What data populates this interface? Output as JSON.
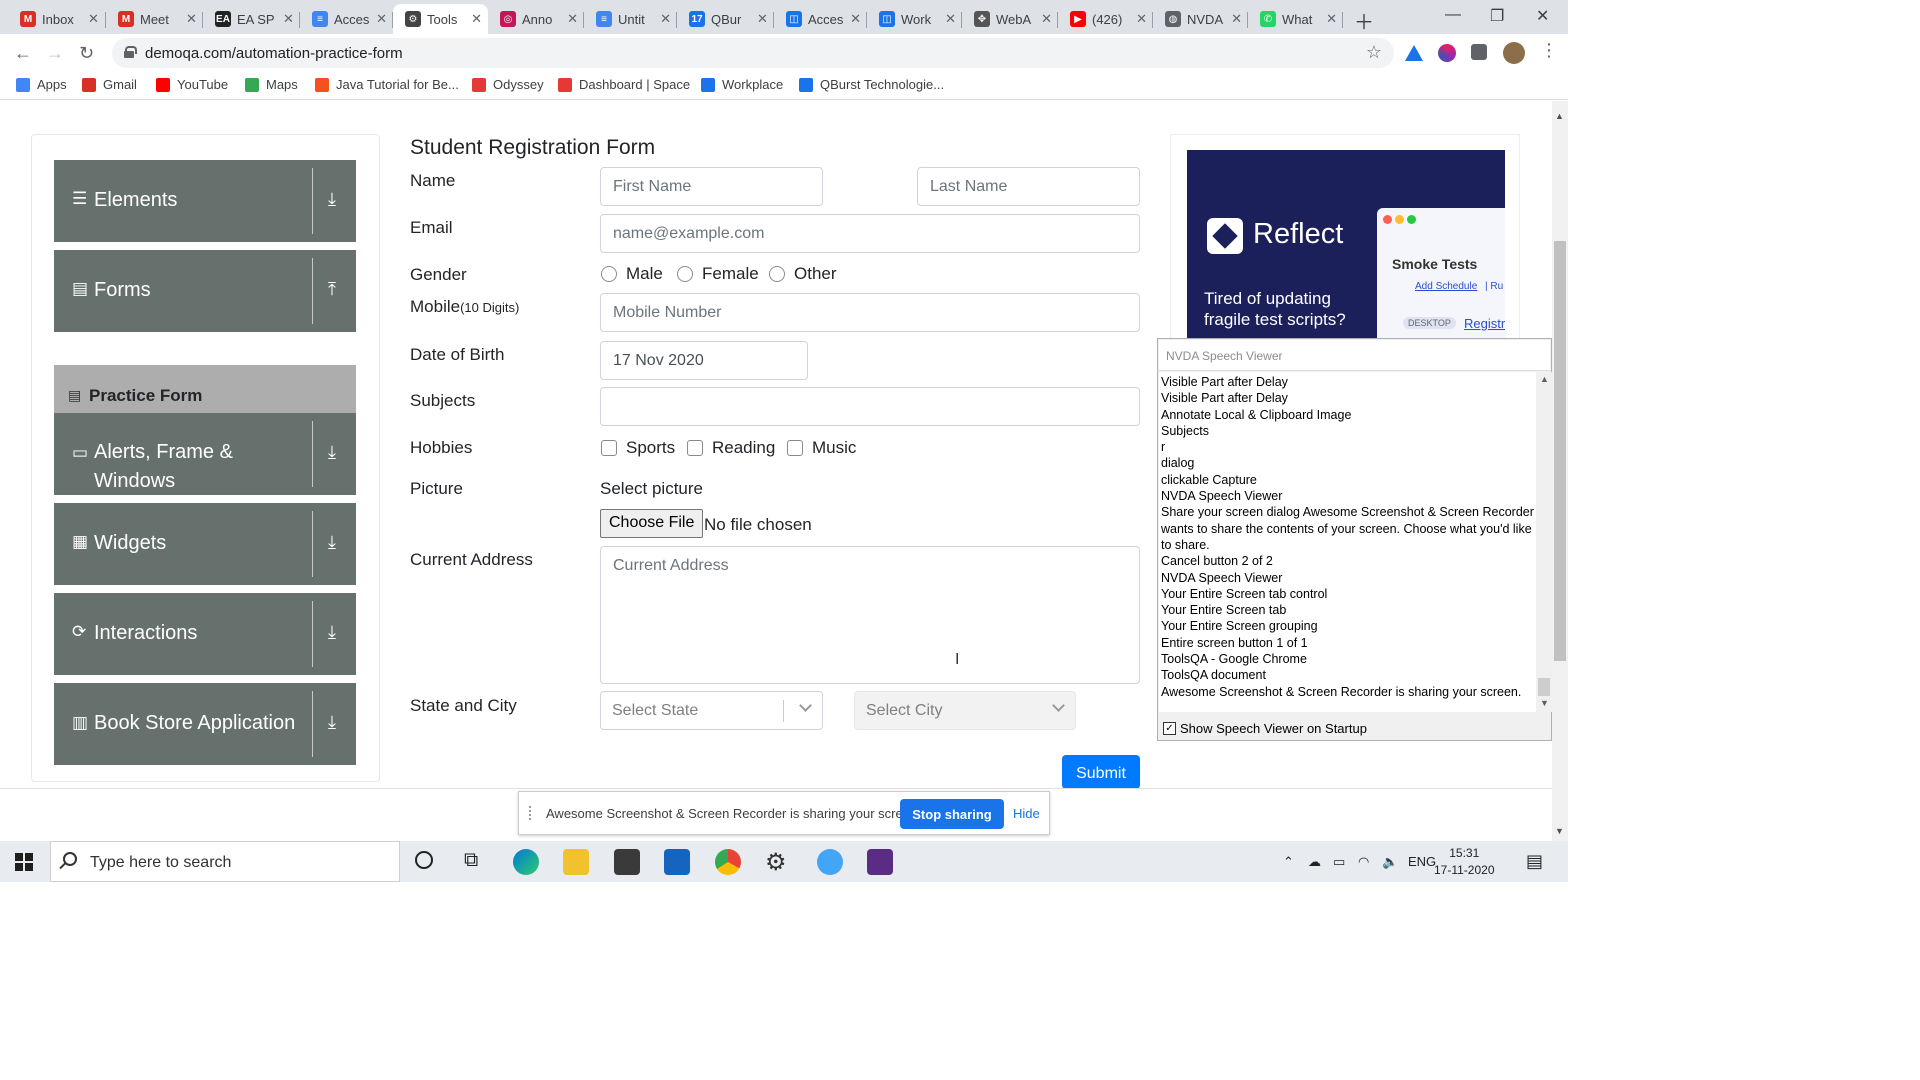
{
  "browser": {
    "tabs": [
      {
        "label": "Inbox",
        "icon": "gmail-icon",
        "color": "#d93025",
        "glyph": "M"
      },
      {
        "label": "Meet",
        "icon": "gmail-icon",
        "color": "#d93025",
        "glyph": "M"
      },
      {
        "label": "EA SP",
        "icon": "ea-icon",
        "color": "#222222",
        "glyph": "EA"
      },
      {
        "label": "Acces",
        "icon": "docs-icon",
        "color": "#4285f4",
        "glyph": "≡"
      },
      {
        "label": "Tools",
        "icon": "gear-icon",
        "color": "#444444",
        "glyph": "⚙",
        "active": true
      },
      {
        "label": "Anno",
        "icon": "annotate-icon",
        "color": "#c2185b",
        "glyph": "◎"
      },
      {
        "label": "Untit",
        "icon": "docs-icon",
        "color": "#4285f4",
        "glyph": "≡"
      },
      {
        "label": "QBur",
        "icon": "calendar-icon",
        "color": "#1a73e8",
        "glyph": "17"
      },
      {
        "label": "Acces",
        "icon": "workplace-icon",
        "color": "#1a73e8",
        "glyph": "◫"
      },
      {
        "label": "Work",
        "icon": "workplace-icon",
        "color": "#1a73e8",
        "glyph": "◫"
      },
      {
        "label": "WebA",
        "icon": "extension-icon",
        "color": "#555555",
        "glyph": "✥"
      },
      {
        "label": "(426)",
        "icon": "youtube-icon",
        "color": "#ff0000",
        "glyph": "▶"
      },
      {
        "label": "NVDA",
        "icon": "globe-icon",
        "color": "#5f6368",
        "glyph": "◍"
      },
      {
        "label": "What",
        "icon": "whatsapp-icon",
        "color": "#25d366",
        "glyph": "✆"
      }
    ],
    "url": "demoqa.com/automation-practice-form",
    "bookmarks": [
      {
        "label": "Apps",
        "color": "#4285f4"
      },
      {
        "label": "Gmail",
        "color": "#d93025"
      },
      {
        "label": "YouTube",
        "color": "#ff0000"
      },
      {
        "label": "Maps",
        "color": "#34a853"
      },
      {
        "label": "Java Tutorial for Be...",
        "color": "#f4511e"
      },
      {
        "label": "Odyssey",
        "color": "#e53935"
      },
      {
        "label": "Dashboard | Space",
        "color": "#e53935"
      },
      {
        "label": "Workplace",
        "color": "#1a73e8"
      },
      {
        "label": "QBurst Technologie...",
        "color": "#1a73e8"
      }
    ]
  },
  "sidebar": {
    "groups": [
      {
        "label": "Elements",
        "icon": "hamburger-icon",
        "arrow": "download-arrow-icon"
      },
      {
        "label": "Forms",
        "icon": "document-icon",
        "arrow": "upload-arrow-icon"
      },
      {
        "label": "Alerts, Frame & Windows",
        "icon": "window-icon",
        "arrow": "download-arrow-icon"
      },
      {
        "label": "Widgets",
        "icon": "widgets-icon",
        "arrow": "download-arrow-icon"
      },
      {
        "label": "Interactions",
        "icon": "interactions-icon",
        "arrow": "download-arrow-icon"
      },
      {
        "label": "Book Store Application",
        "icon": "bookstore-icon",
        "arrow": "download-arrow-icon"
      }
    ],
    "active_item": "Practice Form"
  },
  "form": {
    "title": "Student Registration Form",
    "name_label": "Name",
    "first_name_placeholder": "First Name",
    "last_name_placeholder": "Last Name",
    "email_label": "Email",
    "email_placeholder": "name@example.com",
    "gender_label": "Gender",
    "genders": [
      "Male",
      "Female",
      "Other"
    ],
    "mobile_label": "Mobile",
    "mobile_hint": "(10 Digits)",
    "mobile_placeholder": "Mobile Number",
    "dob_label": "Date of Birth",
    "dob_value": "17 Nov 2020",
    "subjects_label": "Subjects",
    "hobbies_label": "Hobbies",
    "hobbies": [
      "Sports",
      "Reading",
      "Music"
    ],
    "picture_label": "Picture",
    "select_picture": "Select picture",
    "choose_file": "Choose File",
    "no_file": "No file chosen",
    "address_label": "Current Address",
    "address_placeholder": "Current Address",
    "state_city_label": "State and City",
    "state_placeholder": "Select State",
    "city_placeholder": "Select City",
    "submit": "Submit"
  },
  "ad": {
    "brand": "Reflect",
    "tagline": "Tired of updating fragile test scripts?",
    "card_title": "Smoke Tests",
    "schedule": "Add Schedule",
    "schedule_sep": "| Ru",
    "badge": "DESKTOP",
    "link": "Registr"
  },
  "nvda": {
    "title": "NVDA Speech Viewer",
    "lines": [
      "Visible Part after Delay",
      "Visible Part after Delay",
      "Annotate Local & Clipboard Image",
      "Subjects",
      "r",
      "dialog",
      "clickable  Capture",
      "NVDA Speech Viewer",
      "Share your screen  dialog  Awesome Screenshot & Screen Recorder wants to share the contents of your screen. Choose what you'd like to share.",
      "Cancel  button  2 of 2",
      "NVDA Speech Viewer",
      "Your Entire Screen  tab control",
      "Your Entire Screen  tab",
      "Your Entire Screen  grouping",
      "Entire screen  button  1 of 1",
      "ToolsQA - Google Chrome",
      "ToolsQA  document",
      "Awesome Screenshot & Screen Recorder is sharing your screen."
    ],
    "startup_checkbox": "Show Speech Viewer on Startup"
  },
  "sharebar": {
    "message": "Awesome Screenshot & Screen Recorder is sharing your screen.",
    "stop": "Stop sharing",
    "hide": "Hide"
  },
  "taskbar": {
    "search_placeholder": "Type here to search",
    "lang": "ENG",
    "time": "15:31",
    "date": "17-11-2020"
  }
}
